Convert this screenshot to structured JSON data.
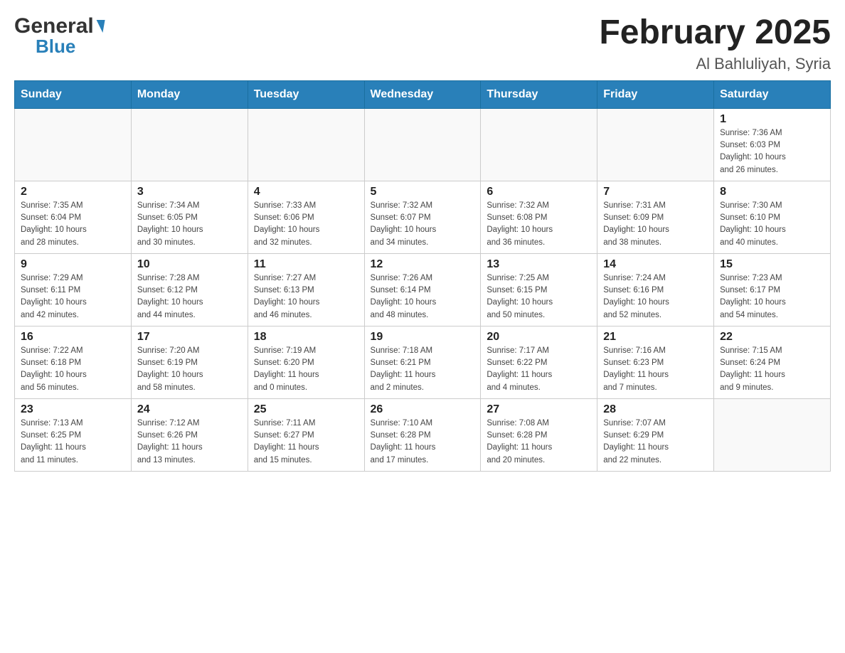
{
  "header": {
    "logo_general": "General",
    "logo_blue": "Blue",
    "month_title": "February 2025",
    "location": "Al Bahluliyah, Syria"
  },
  "days_of_week": [
    "Sunday",
    "Monday",
    "Tuesday",
    "Wednesday",
    "Thursday",
    "Friday",
    "Saturday"
  ],
  "weeks": [
    [
      {
        "day": "",
        "info": ""
      },
      {
        "day": "",
        "info": ""
      },
      {
        "day": "",
        "info": ""
      },
      {
        "day": "",
        "info": ""
      },
      {
        "day": "",
        "info": ""
      },
      {
        "day": "",
        "info": ""
      },
      {
        "day": "1",
        "info": "Sunrise: 7:36 AM\nSunset: 6:03 PM\nDaylight: 10 hours\nand 26 minutes."
      }
    ],
    [
      {
        "day": "2",
        "info": "Sunrise: 7:35 AM\nSunset: 6:04 PM\nDaylight: 10 hours\nand 28 minutes."
      },
      {
        "day": "3",
        "info": "Sunrise: 7:34 AM\nSunset: 6:05 PM\nDaylight: 10 hours\nand 30 minutes."
      },
      {
        "day": "4",
        "info": "Sunrise: 7:33 AM\nSunset: 6:06 PM\nDaylight: 10 hours\nand 32 minutes."
      },
      {
        "day": "5",
        "info": "Sunrise: 7:32 AM\nSunset: 6:07 PM\nDaylight: 10 hours\nand 34 minutes."
      },
      {
        "day": "6",
        "info": "Sunrise: 7:32 AM\nSunset: 6:08 PM\nDaylight: 10 hours\nand 36 minutes."
      },
      {
        "day": "7",
        "info": "Sunrise: 7:31 AM\nSunset: 6:09 PM\nDaylight: 10 hours\nand 38 minutes."
      },
      {
        "day": "8",
        "info": "Sunrise: 7:30 AM\nSunset: 6:10 PM\nDaylight: 10 hours\nand 40 minutes."
      }
    ],
    [
      {
        "day": "9",
        "info": "Sunrise: 7:29 AM\nSunset: 6:11 PM\nDaylight: 10 hours\nand 42 minutes."
      },
      {
        "day": "10",
        "info": "Sunrise: 7:28 AM\nSunset: 6:12 PM\nDaylight: 10 hours\nand 44 minutes."
      },
      {
        "day": "11",
        "info": "Sunrise: 7:27 AM\nSunset: 6:13 PM\nDaylight: 10 hours\nand 46 minutes."
      },
      {
        "day": "12",
        "info": "Sunrise: 7:26 AM\nSunset: 6:14 PM\nDaylight: 10 hours\nand 48 minutes."
      },
      {
        "day": "13",
        "info": "Sunrise: 7:25 AM\nSunset: 6:15 PM\nDaylight: 10 hours\nand 50 minutes."
      },
      {
        "day": "14",
        "info": "Sunrise: 7:24 AM\nSunset: 6:16 PM\nDaylight: 10 hours\nand 52 minutes."
      },
      {
        "day": "15",
        "info": "Sunrise: 7:23 AM\nSunset: 6:17 PM\nDaylight: 10 hours\nand 54 minutes."
      }
    ],
    [
      {
        "day": "16",
        "info": "Sunrise: 7:22 AM\nSunset: 6:18 PM\nDaylight: 10 hours\nand 56 minutes."
      },
      {
        "day": "17",
        "info": "Sunrise: 7:20 AM\nSunset: 6:19 PM\nDaylight: 10 hours\nand 58 minutes."
      },
      {
        "day": "18",
        "info": "Sunrise: 7:19 AM\nSunset: 6:20 PM\nDaylight: 11 hours\nand 0 minutes."
      },
      {
        "day": "19",
        "info": "Sunrise: 7:18 AM\nSunset: 6:21 PM\nDaylight: 11 hours\nand 2 minutes."
      },
      {
        "day": "20",
        "info": "Sunrise: 7:17 AM\nSunset: 6:22 PM\nDaylight: 11 hours\nand 4 minutes."
      },
      {
        "day": "21",
        "info": "Sunrise: 7:16 AM\nSunset: 6:23 PM\nDaylight: 11 hours\nand 7 minutes."
      },
      {
        "day": "22",
        "info": "Sunrise: 7:15 AM\nSunset: 6:24 PM\nDaylight: 11 hours\nand 9 minutes."
      }
    ],
    [
      {
        "day": "23",
        "info": "Sunrise: 7:13 AM\nSunset: 6:25 PM\nDaylight: 11 hours\nand 11 minutes."
      },
      {
        "day": "24",
        "info": "Sunrise: 7:12 AM\nSunset: 6:26 PM\nDaylight: 11 hours\nand 13 minutes."
      },
      {
        "day": "25",
        "info": "Sunrise: 7:11 AM\nSunset: 6:27 PM\nDaylight: 11 hours\nand 15 minutes."
      },
      {
        "day": "26",
        "info": "Sunrise: 7:10 AM\nSunset: 6:28 PM\nDaylight: 11 hours\nand 17 minutes."
      },
      {
        "day": "27",
        "info": "Sunrise: 7:08 AM\nSunset: 6:28 PM\nDaylight: 11 hours\nand 20 minutes."
      },
      {
        "day": "28",
        "info": "Sunrise: 7:07 AM\nSunset: 6:29 PM\nDaylight: 11 hours\nand 22 minutes."
      },
      {
        "day": "",
        "info": ""
      }
    ]
  ]
}
